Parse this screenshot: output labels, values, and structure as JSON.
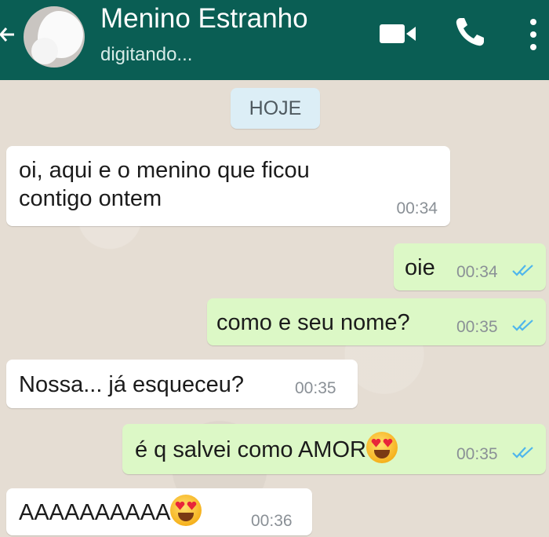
{
  "header": {
    "contact_name": "Menino Estranho",
    "status": "digitando...",
    "colors": {
      "bar": "#0a5e54",
      "text": "#ffffff"
    },
    "icons": [
      "back-arrow-icon",
      "video-call-icon",
      "phone-call-icon",
      "more-options-icon"
    ]
  },
  "chat": {
    "date_label": "HOJE",
    "messages": [
      {
        "dir": "in",
        "lines": [
          "oi, aqui e o menino que ficou",
          "contigo ontem"
        ],
        "time": "00:34"
      },
      {
        "dir": "out",
        "text": "oie",
        "time": "00:34",
        "read": true
      },
      {
        "dir": "out",
        "text": "como e seu nome?",
        "time": "00:35",
        "read": true
      },
      {
        "dir": "in",
        "text": "Nossa... já esqueceu?",
        "time": "00:35"
      },
      {
        "dir": "out",
        "text": "é q salvei como AMOR",
        "emoji": "heart-eyes",
        "time": "00:35",
        "read": true
      },
      {
        "dir": "in",
        "text": "AAAAAAAAAA",
        "emoji": "heart-eyes",
        "time": "00:36"
      }
    ],
    "colors": {
      "incoming": "#ffffff",
      "outgoing": "#dcf8c6",
      "ticks": "#4fb6ec"
    }
  }
}
